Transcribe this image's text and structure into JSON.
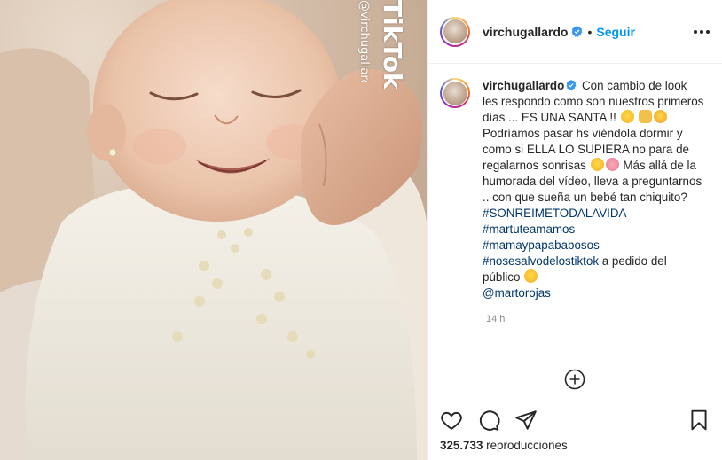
{
  "watermark": {
    "brand": "TikTok",
    "user": "@virchugallardo"
  },
  "header": {
    "username": "virchugallardo",
    "separator": "•",
    "follow_label": "Seguir"
  },
  "caption": {
    "username": "virchugallardo",
    "line1": "Con cambio de look les respondo como son nuestros primeros días ... ES UNA SANTA !! ",
    "line2": " Podríamos pasar hs viéndola dormir y como si ELLA LO SUPIERA no para de regalarnos sonrisas ",
    "line3": "Más allá de la humorada del vídeo, lleva a preguntarnos .. con que sueña un bebé tan chiquito?",
    "hashtags": [
      "#SONREIMETODALAVIDA",
      "#martuteamamos",
      "#mamaypapababosos",
      "#nosesalvodelostiktok"
    ],
    "after_hashtags": " a pedido del público ",
    "mention": "@martorojas",
    "time": "14 h"
  },
  "icons": {
    "verified": "verified-badge-icon",
    "more": "more-options-icon",
    "load_more": "add-circle-icon",
    "like": "heart-icon",
    "comment": "comment-icon",
    "share": "share-icon",
    "save": "bookmark-icon"
  },
  "stats": {
    "views_count": "325.733",
    "views_label": "reproducciones"
  },
  "colors": {
    "link": "#0095f6",
    "hashtag": "#00376b",
    "muted": "#8e8e8e",
    "text": "#262626"
  }
}
